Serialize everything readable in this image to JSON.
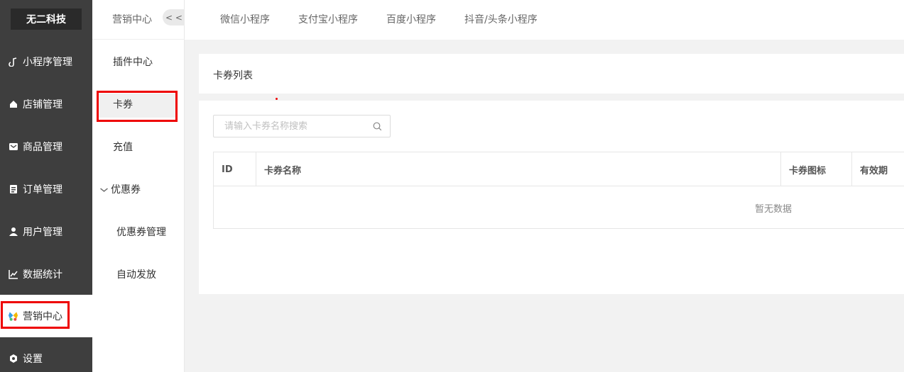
{
  "sidebar": {
    "brand": "无二科技",
    "items": [
      {
        "label": "小程序管理",
        "icon": "link-icon"
      },
      {
        "label": "店铺管理",
        "icon": "home-icon"
      },
      {
        "label": "商品管理",
        "icon": "mail-icon"
      },
      {
        "label": "订单管理",
        "icon": "clipboard-icon"
      },
      {
        "label": "用户管理",
        "icon": "user-icon"
      },
      {
        "label": "数据统计",
        "icon": "chart-icon"
      },
      {
        "label": "营销中心",
        "icon": "marketing-icon",
        "active": true
      },
      {
        "label": "设置",
        "icon": "gear-icon"
      }
    ]
  },
  "subnav": {
    "title": "营销中心",
    "collapse": "< <",
    "items": [
      {
        "label": "插件中心"
      },
      {
        "label": "卡券",
        "active": true
      },
      {
        "label": "充值"
      },
      {
        "label": "优惠券",
        "expanded": true
      },
      {
        "label": "优惠券管理"
      },
      {
        "label": "自动发放"
      }
    ]
  },
  "tabs": [
    "微信小程序",
    "支付宝小程序",
    "百度小程序",
    "抖音/头条小程序"
  ],
  "card": {
    "title": "卡券列表",
    "search_placeholder": "请输入卡券名称搜索",
    "columns": [
      "ID",
      "卡券名称",
      "卡券图标",
      "有效期"
    ],
    "empty_text": "暂无数据"
  },
  "colors": {
    "sidebar_bg": "#3e3e3e",
    "highlight": "#ee0000",
    "page_bg": "#f2f2f2"
  }
}
